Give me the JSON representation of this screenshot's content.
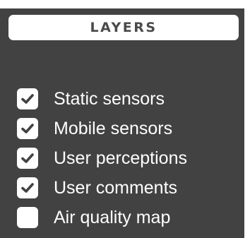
{
  "layers": {
    "title": "LAYERS",
    "items": [
      {
        "label": "Static sensors",
        "checked": true
      },
      {
        "label": "Mobile sensors",
        "checked": true
      },
      {
        "label": "User perceptions",
        "checked": true
      },
      {
        "label": "User comments",
        "checked": true
      },
      {
        "label": "Air quality map",
        "checked": false
      }
    ]
  },
  "colors": {
    "panel_bg": "#424242",
    "check": "#424242",
    "text": "#ffffff"
  },
  "icons": {
    "checkmark": "checkmark-icon"
  }
}
